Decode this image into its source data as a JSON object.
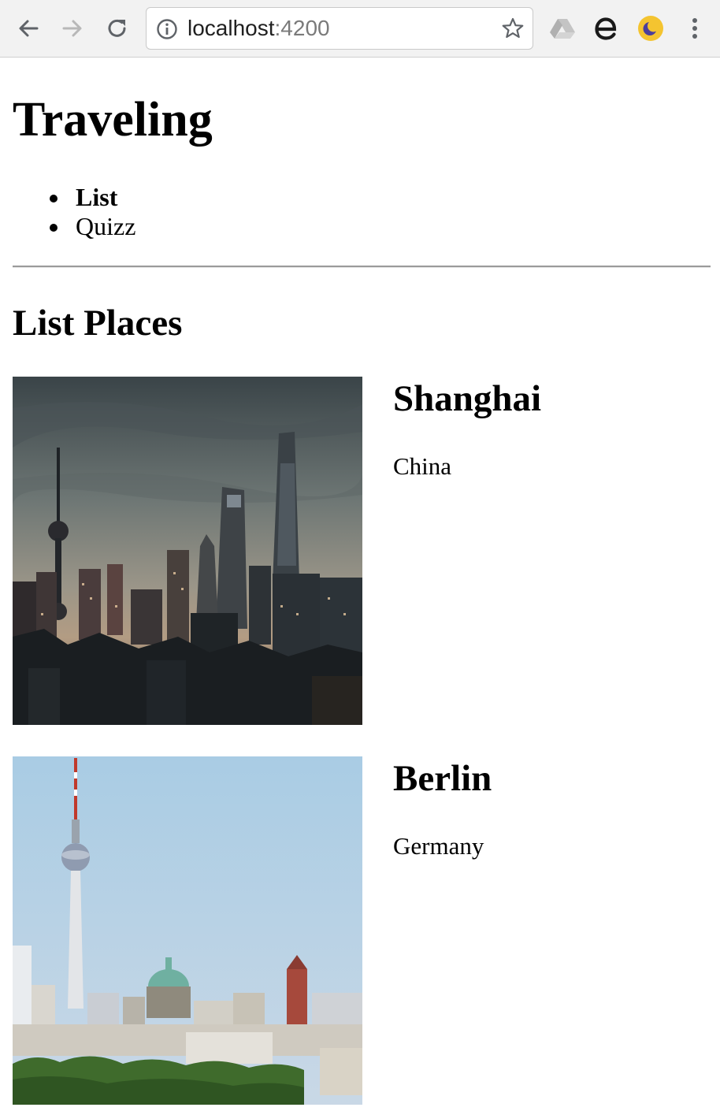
{
  "browser": {
    "url_host": "localhost",
    "url_port": ":4200",
    "icons": [
      "back-arrow-icon",
      "forward-arrow-icon",
      "reload-icon",
      "info-icon",
      "star-icon",
      "drive-icon",
      "extension-e-icon",
      "night-mode-icon",
      "menu-dots-icon"
    ],
    "colors": {
      "toolbar": "#f2f2f2",
      "forward_disabled": "#b8b8b8",
      "night_mode_badge": "#f4c430"
    }
  },
  "header": {
    "title": "Traveling",
    "nav": [
      {
        "label": "List",
        "active": true
      },
      {
        "label": "Quizz",
        "active": false
      }
    ]
  },
  "main": {
    "title": "List Places",
    "places": [
      {
        "name": "Shanghai",
        "country": "China",
        "image": "shanghai-skyline-photo"
      },
      {
        "name": "Berlin",
        "country": "Germany",
        "image": "berlin-skyline-photo"
      }
    ]
  }
}
